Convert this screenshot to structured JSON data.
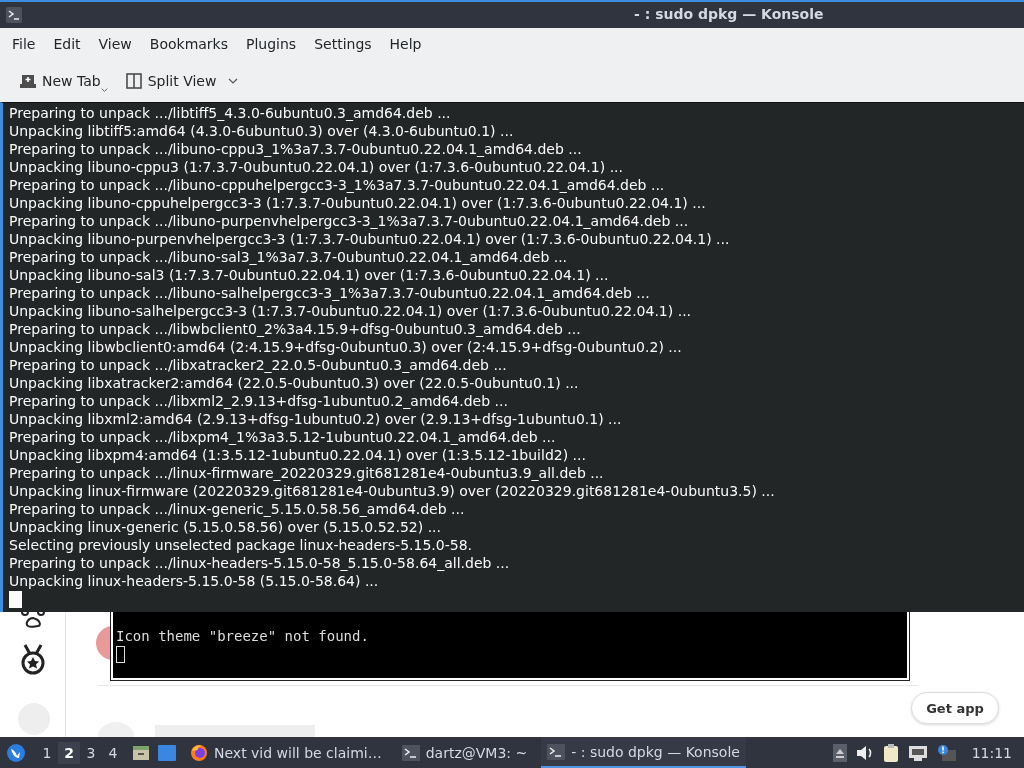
{
  "window": {
    "title": "- : sudo dpkg — Konsole"
  },
  "menu": [
    "File",
    "Edit",
    "View",
    "Bookmarks",
    "Plugins",
    "Settings",
    "Help"
  ],
  "toolbar": [
    {
      "kind": "new-tab",
      "label": "New Tab"
    },
    {
      "kind": "split-view",
      "label": "Split View"
    }
  ],
  "terminal": {
    "lines": [
      "Preparing to unpack .../libtiff5_4.3.0-6ubuntu0.3_amd64.deb ...",
      "Unpacking libtiff5:amd64 (4.3.0-6ubuntu0.3) over (4.3.0-6ubuntu0.1) ...",
      "Preparing to unpack .../libuno-cppu3_1%3a7.3.7-0ubuntu0.22.04.1_amd64.deb ...",
      "Unpacking libuno-cppu3 (1:7.3.7-0ubuntu0.22.04.1) over (1:7.3.6-0ubuntu0.22.04.1) ...",
      "Preparing to unpack .../libuno-cppuhelpergcc3-3_1%3a7.3.7-0ubuntu0.22.04.1_amd64.deb ...",
      "Unpacking libuno-cppuhelpergcc3-3 (1:7.3.7-0ubuntu0.22.04.1) over (1:7.3.6-0ubuntu0.22.04.1) ...",
      "Preparing to unpack .../libuno-purpenvhelpergcc3-3_1%3a7.3.7-0ubuntu0.22.04.1_amd64.deb ...",
      "Unpacking libuno-purpenvhelpergcc3-3 (1:7.3.7-0ubuntu0.22.04.1) over (1:7.3.6-0ubuntu0.22.04.1) ...",
      "Preparing to unpack .../libuno-sal3_1%3a7.3.7-0ubuntu0.22.04.1_amd64.deb ...",
      "Unpacking libuno-sal3 (1:7.3.7-0ubuntu0.22.04.1) over (1:7.3.6-0ubuntu0.22.04.1) ...",
      "Preparing to unpack .../libuno-salhelpergcc3-3_1%3a7.3.7-0ubuntu0.22.04.1_amd64.deb ...",
      "Unpacking libuno-salhelpergcc3-3 (1:7.3.7-0ubuntu0.22.04.1) over (1:7.3.6-0ubuntu0.22.04.1) ...",
      "Preparing to unpack .../libwbclient0_2%3a4.15.9+dfsg-0ubuntu0.3_amd64.deb ...",
      "Unpacking libwbclient0:amd64 (2:4.15.9+dfsg-0ubuntu0.3) over (2:4.15.9+dfsg-0ubuntu0.2) ...",
      "Preparing to unpack .../libxatracker2_22.0.5-0ubuntu0.3_amd64.deb ...",
      "Unpacking libxatracker2:amd64 (22.0.5-0ubuntu0.3) over (22.0.5-0ubuntu0.1) ...",
      "Preparing to unpack .../libxml2_2.9.13+dfsg-1ubuntu0.2_amd64.deb ...",
      "Unpacking libxml2:amd64 (2.9.13+dfsg-1ubuntu0.2) over (2.9.13+dfsg-1ubuntu0.1) ...",
      "Preparing to unpack .../libxpm4_1%3a3.5.12-1ubuntu0.22.04.1_amd64.deb ...",
      "Unpacking libxpm4:amd64 (1:3.5.12-1ubuntu0.22.04.1) over (1:3.5.12-1build2) ...",
      "Preparing to unpack .../linux-firmware_20220329.git681281e4-0ubuntu3.9_all.deb ...",
      "Unpacking linux-firmware (20220329.git681281e4-0ubuntu3.9) over (20220329.git681281e4-0ubuntu3.5) ...",
      "Preparing to unpack .../linux-generic_5.15.0.58.56_amd64.deb ...",
      "Unpacking linux-generic (5.15.0.58.56) over (5.15.0.52.52) ...",
      "Selecting previously unselected package linux-headers-5.15.0-58.",
      "Preparing to unpack .../linux-headers-5.15.0-58_5.15.0-58.64_all.deb ...",
      "Unpacking linux-headers-5.15.0-58 (5.15.0-58.64) ..."
    ]
  },
  "background": {
    "console_lines": [
      "Icon theme \"breeze\" not found."
    ],
    "button": "Get app"
  },
  "taskbar": {
    "desktops": [
      {
        "label": "1",
        "selected": false
      },
      {
        "label": "2",
        "selected": true
      },
      {
        "label": "3",
        "selected": false
      },
      {
        "label": "4",
        "selected": false
      }
    ],
    "tasks": [
      {
        "kind": "browser",
        "label": "Next vid will be claimi…",
        "selected": false
      },
      {
        "kind": "terminal",
        "label": "dartz@VM3: ~",
        "selected": false
      },
      {
        "kind": "terminal",
        "label": "- : sudo dpkg — Konsole",
        "selected": true
      }
    ],
    "clock": "11:11"
  }
}
